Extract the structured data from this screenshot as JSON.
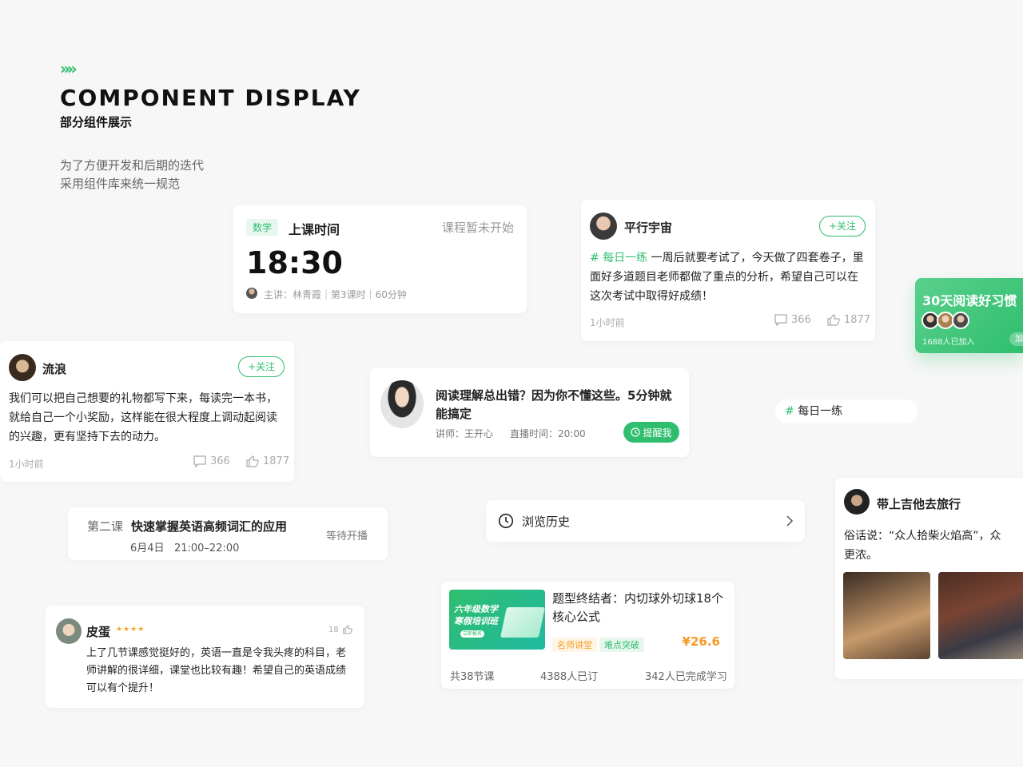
{
  "header": {
    "chevrons": "»»",
    "title": "COMPONENT DISPLAY",
    "subtitle": "部分组件展示",
    "desc_line1": "为了方便开发和后期的迭代",
    "desc_line2": "采用组件库来统一规范"
  },
  "class_time": {
    "subject_tag": "数学",
    "label": "上课时间",
    "status": "课程暂未开始",
    "time": "18:30",
    "meta": "主讲：林青霞｜第3课时｜60分钟"
  },
  "post_parallel": {
    "author": "平行宇宙",
    "follow": "+关注",
    "hashtag": "# 每日一练",
    "text": " 一周后就要考试了，今天做了四套卷子，里面好多道题目老师都做了重点的分析，希望自己可以在这次考试中取得好成绩！",
    "time": "1小时前",
    "comments": "366",
    "likes": "1877"
  },
  "reading_challenge": {
    "title": "30天阅读好习惯",
    "joined": "1688人已加入",
    "join_btn": "加入"
  },
  "post_wander": {
    "author": "流浪",
    "follow": "+关注",
    "text": "我们可以把自己想要的礼物都写下来，每读完一本书，就给自己一个小奖励，这样能在很大程度上调动起阅读的兴趣，更有坚持下去的动力。",
    "time": "1小时前",
    "comments": "366",
    "likes": "1877"
  },
  "live": {
    "title": "阅读理解总出错？因为你不懂这些。5分钟就能搞定",
    "teacher": "讲师：王开心",
    "time": "直播时间：20:00",
    "remind": "提醒我"
  },
  "hashtag_chip": {
    "text": "每日一练",
    "hash": "#"
  },
  "lesson": {
    "index": "第二课",
    "title": "快速掌握英语高频词汇的应用",
    "datetime": "6月4日   21:00–22:00",
    "status": "等待开播"
  },
  "history": {
    "label": "浏览历史"
  },
  "travel": {
    "author": "带上吉他去旅行",
    "text_line1": "俗话说：“众人拾柴火焰高”，众",
    "text_line2": "更浓。"
  },
  "review": {
    "author": "皮蛋",
    "stars": "★★★★",
    "likes": "18",
    "text": "上了几节课感觉挺好的，英语一直是令我头疼的科目，老师讲解的很详细，课堂也比较有趣！希望自己的英语成绩可以有个提升！"
  },
  "course": {
    "cover_line1": "六年级数学",
    "cover_line2": "寒假培训班",
    "cover_btn": "立即报名",
    "title": "题型终结者：内切球外切球18个核心公式",
    "tag1": "名师讲堂",
    "tag2": "难点突破",
    "price": "¥26.6",
    "lessons": "共38节课",
    "subscribed": "4388人已订",
    "completed": "342人已完成学习"
  },
  "colors": {
    "accent": "#2fbe6e",
    "star": "#f5a623",
    "price": "#f59a23"
  }
}
